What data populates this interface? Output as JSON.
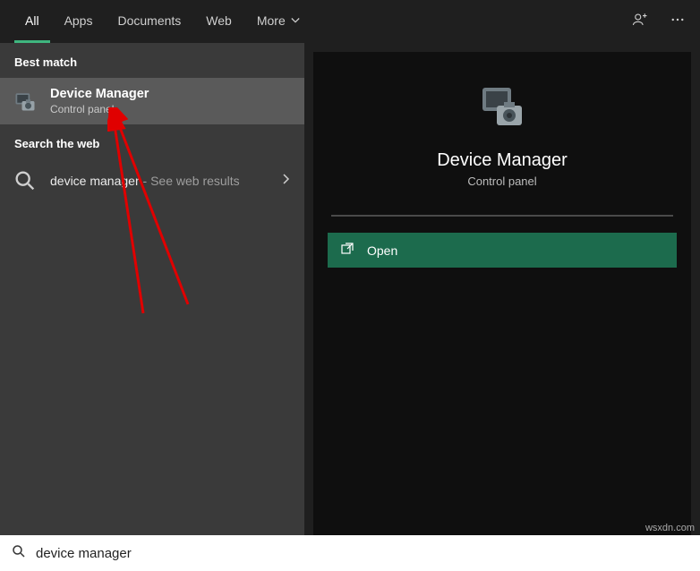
{
  "tabs": {
    "all": "All",
    "apps": "Apps",
    "documents": "Documents",
    "web": "Web",
    "more": "More"
  },
  "left": {
    "best_match_header": "Best match",
    "best_match": {
      "title": "Device Manager",
      "subtitle": "Control panel"
    },
    "search_web_header": "Search the web",
    "web_result_prefix": "device manager",
    "web_result_suffix": " - See web results"
  },
  "detail": {
    "title": "Device Manager",
    "subtitle": "Control panel",
    "open_label": "Open"
  },
  "search_value": "device manager",
  "watermark": "wsxdn.com"
}
